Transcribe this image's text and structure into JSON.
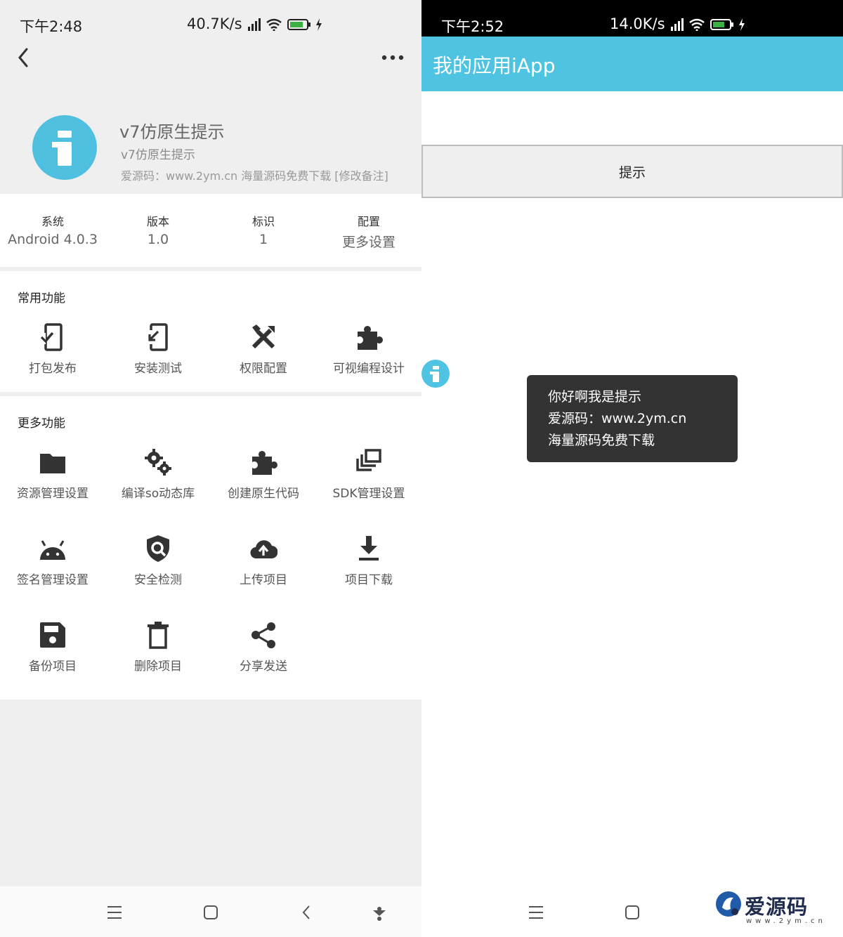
{
  "left": {
    "status": {
      "time": "下午2:48",
      "network": "40.7K/s"
    },
    "app": {
      "name": "v7仿原生提示",
      "package": "v7仿原生提示",
      "note": "爱源码：www.2ym.cn 海量源码免费下载 [修改备注]"
    },
    "info": [
      {
        "label": "系统",
        "value": "Android 4.0.3"
      },
      {
        "label": "版本",
        "value": "1.0"
      },
      {
        "label": "标识",
        "value": "1"
      },
      {
        "label": "配置",
        "value": "更多设置"
      }
    ],
    "common": {
      "title": "常用功能",
      "items": [
        {
          "label": "打包发布",
          "icon": "package-publish-icon"
        },
        {
          "label": "安装测试",
          "icon": "install-test-icon"
        },
        {
          "label": "权限配置",
          "icon": "tools-icon"
        },
        {
          "label": "可视编程设计",
          "icon": "puzzle-icon"
        }
      ]
    },
    "more": {
      "title": "更多功能",
      "items": [
        {
          "label": "资源管理设置",
          "icon": "folder-icon"
        },
        {
          "label": "编译so动态库",
          "icon": "gears-icon"
        },
        {
          "label": "创建原生代码",
          "icon": "puzzle-icon"
        },
        {
          "label": "SDK管理设置",
          "icon": "library-icon"
        },
        {
          "label": "签名管理设置",
          "icon": "android-icon"
        },
        {
          "label": "安全检测",
          "icon": "shield-search-icon"
        },
        {
          "label": "上传项目",
          "icon": "cloud-upload-icon"
        },
        {
          "label": "项目下载",
          "icon": "download-icon"
        },
        {
          "label": "备份项目",
          "icon": "save-icon"
        },
        {
          "label": "删除项目",
          "icon": "delete-icon"
        },
        {
          "label": "分享发送",
          "icon": "share-icon"
        }
      ]
    }
  },
  "right": {
    "status": {
      "time": "下午2:52",
      "network": "14.0K/s"
    },
    "appbar_title": "我的应用iApp",
    "button_label": "提示",
    "toast_lines": [
      "你好啊我是提示",
      "爱源码：www.2ym.cn",
      "海量源码免费下载"
    ],
    "watermark": {
      "text": "爱源码",
      "sub": "www.2ym.cn"
    }
  },
  "colors": {
    "accent": "#4fc3e2",
    "toast_bg": "#333333",
    "icon": "#333333"
  }
}
